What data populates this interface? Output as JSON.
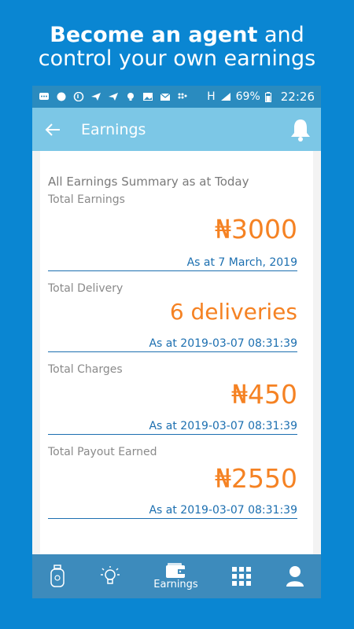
{
  "promo": {
    "line1_bold": "Become an agent",
    "line1_rest": " and",
    "line2": "control your own earnings"
  },
  "status_bar": {
    "battery": "69%",
    "time": "22:26",
    "network": "H"
  },
  "header": {
    "title": "Earnings",
    "back_icon": "back-arrow-icon",
    "notification_icon": "bell-icon"
  },
  "summary": {
    "title": "All Earnings Summary as at Today"
  },
  "sections": [
    {
      "label": "Total Earnings",
      "value": "₦3000",
      "date": "As at 7 March, 2019"
    },
    {
      "label": "Total Delivery",
      "value": "6 deliveries",
      "date": "As at 2019-03-07 08:31:39"
    },
    {
      "label": "Total Charges",
      "value": "₦450",
      "date": "As at 2019-03-07 08:31:39"
    },
    {
      "label": "Total Payout Earned",
      "value": "₦2550",
      "date": "As at 2019-03-07 08:31:39"
    }
  ],
  "bottom_nav": {
    "items": [
      {
        "icon": "gas-cylinder-icon",
        "label": ""
      },
      {
        "icon": "lightbulb-icon",
        "label": ""
      },
      {
        "icon": "wallet-icon",
        "label": "Earnings"
      },
      {
        "icon": "grid-icon",
        "label": ""
      },
      {
        "icon": "user-icon",
        "label": ""
      }
    ]
  },
  "colors": {
    "background": "#0a86d2",
    "appbar": "#7cc7e6",
    "accent_orange": "#f58223",
    "date_blue": "#1c6fb0",
    "bottom_nav": "#3d8bbc"
  }
}
